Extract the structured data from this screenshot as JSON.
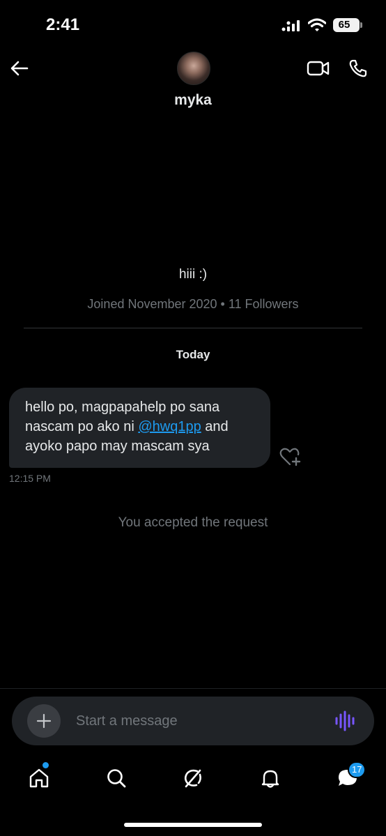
{
  "status_bar": {
    "time": "2:41",
    "battery": "65",
    "icons": [
      "cellular-signal-icon",
      "wifi-icon",
      "battery-icon"
    ]
  },
  "header": {
    "name": "myka",
    "icons": [
      "back-arrow-icon",
      "avatar",
      "video-camera-icon",
      "phone-icon"
    ]
  },
  "profile": {
    "bio": "hiii :)",
    "joined": "Joined November 2020 • 11 Followers"
  },
  "conversation": {
    "date_separator": "Today",
    "messages": [
      {
        "text_before": "hello po, magpapahelp po sana nascam po ako ni ",
        "mention": "@hwq1pp",
        "text_after": " and ayoko papo may mascam sya",
        "time": "12:15 PM"
      }
    ],
    "system_note": "You accepted the request"
  },
  "composer": {
    "placeholder": "Start a message",
    "icons": [
      "plus-icon",
      "voice-wave-icon"
    ]
  },
  "tabbar": {
    "items": [
      "home-icon",
      "search-icon",
      "grok-icon",
      "notifications-bell-icon",
      "messages-icon"
    ],
    "messages_badge": "17"
  },
  "colors": {
    "background": "#000000",
    "bubble": "#202327",
    "accent": "#1d9bf0",
    "secondary_text": "#71767b",
    "voice_accent": "#7856ff"
  }
}
